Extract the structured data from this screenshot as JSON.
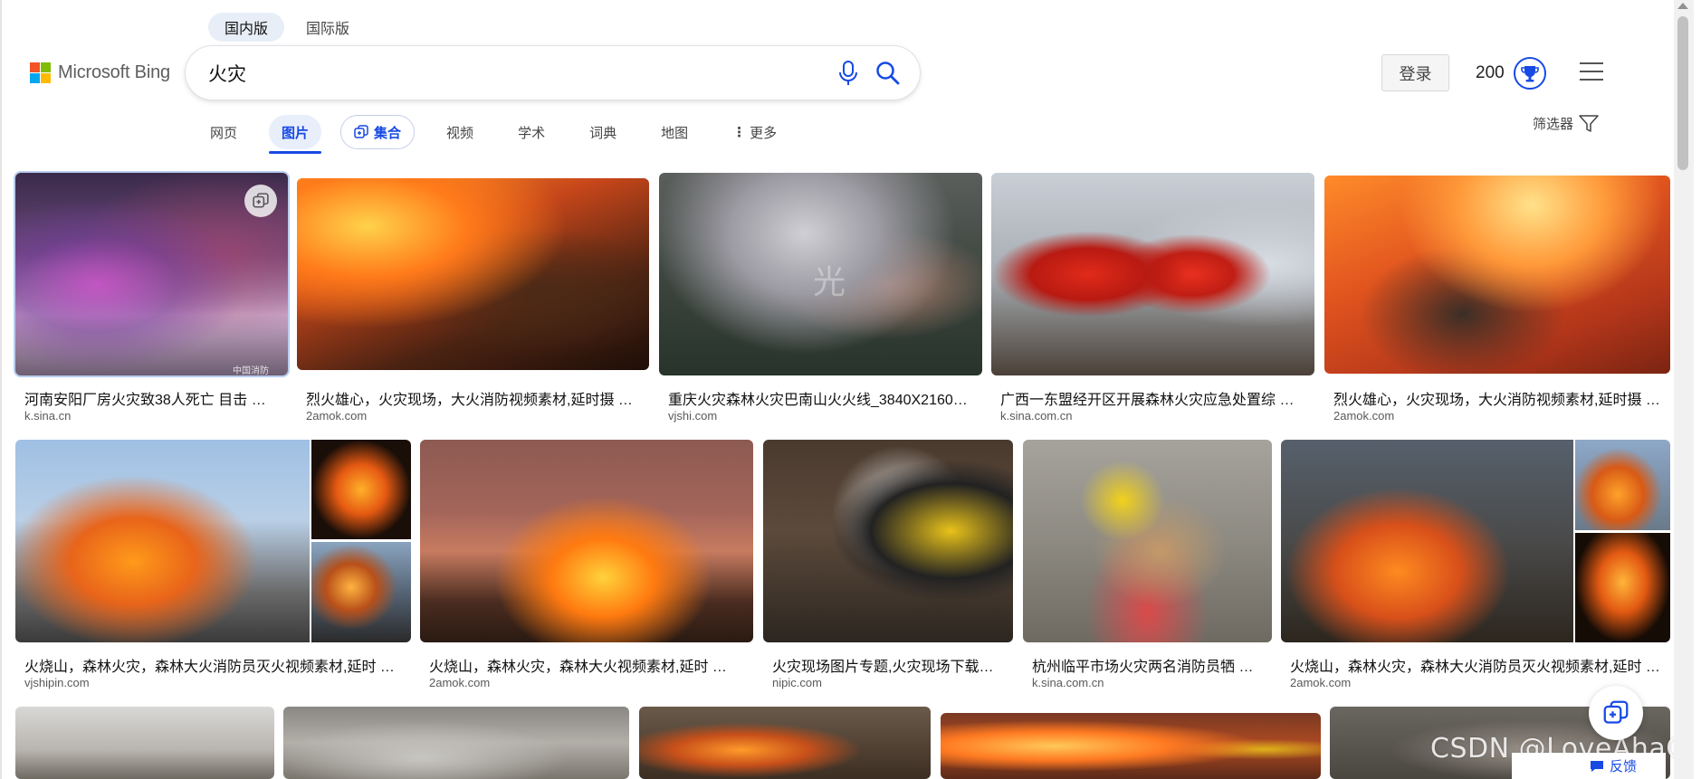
{
  "region_tabs": [
    "国内版",
    "国际版"
  ],
  "logo_text": "Microsoft Bing",
  "logo_colors": [
    "#f35325",
    "#81bc06",
    "#05a6f0",
    "#ffba08"
  ],
  "search": {
    "query": "火灾",
    "placeholder": ""
  },
  "header": {
    "login_label": "登录",
    "rewards_points": "200",
    "accent": "#174ae4"
  },
  "nav": {
    "items": [
      {
        "label": "网页"
      },
      {
        "label": "图片"
      },
      {
        "label": "集合"
      },
      {
        "label": "视频"
      },
      {
        "label": "学术"
      },
      {
        "label": "词典"
      },
      {
        "label": "地图"
      },
      {
        "label": "更多"
      }
    ],
    "active": "图片",
    "filter_label": "筛选器"
  },
  "results": [
    {
      "caption": "河南安阳厂房火灾致38人死亡 目击 …",
      "source": "k.sina.cn",
      "watermark": "中国消防"
    },
    {
      "caption": "烈火雄心，火灾现场，大火消防视频素材,延时摄 …",
      "source": "2amok.com"
    },
    {
      "caption": "重庆火灾森林火灾巴南山火火线_3840X2160…",
      "source": "vjshi.com",
      "watermark": "光"
    },
    {
      "caption": "广西一东盟经开区开展森林火灾应急处置综 …",
      "source": "k.sina.com.cn"
    },
    {
      "caption": "烈火雄心，火灾现场，大火消防视频素材,延时摄 …",
      "source": "2amok.com"
    },
    {
      "caption": "火烧山，森林火灾，森林大火消防员灭火视频素材,延时 …",
      "source": "vjshipin.com"
    },
    {
      "caption": "火烧山，森林火灾，森林大火视频素材,延时 …",
      "source": "2amok.com"
    },
    {
      "caption": "火灾现场图片专题,火灾现场下载…",
      "source": "nipic.com"
    },
    {
      "caption": "杭州临平市场火灾两名消防员牺 …",
      "source": "k.sina.com.cn"
    },
    {
      "caption": "火烧山，森林火灾，森林大火消防员灭火视频素材,延时 …",
      "source": "2amok.com"
    }
  ],
  "feedback_label": "反馈",
  "overlay_watermark": "CSDN @LoveAhaC"
}
